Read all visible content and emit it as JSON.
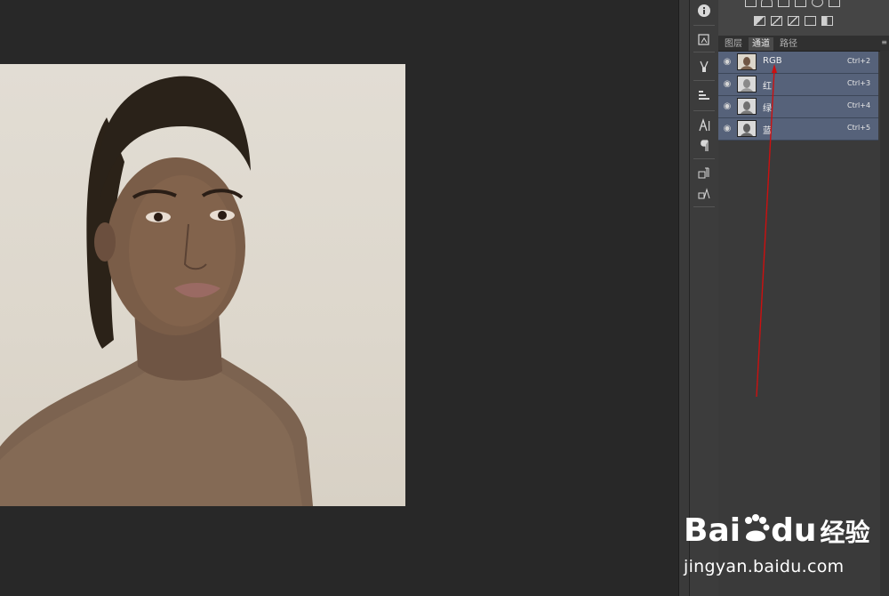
{
  "panel": {
    "tabs": [
      {
        "label": "图层",
        "active": false
      },
      {
        "label": "通道",
        "active": true
      },
      {
        "label": "路径",
        "active": false
      }
    ],
    "channels": [
      {
        "name": "RGB",
        "shortcut": "Ctrl+2"
      },
      {
        "name": "红",
        "shortcut": "Ctrl+3"
      },
      {
        "name": "绿",
        "shortcut": "Ctrl+4"
      },
      {
        "name": "蓝",
        "shortcut": "Ctrl+5"
      }
    ]
  },
  "watermark": {
    "brand_latin": "Bai",
    "brand_latin2": "du",
    "brand_cn": "经验",
    "domain": "jingyan.baidu.com"
  },
  "colors": {
    "selected_row": "#56627a",
    "annotation_arrow": "#cc1010"
  }
}
